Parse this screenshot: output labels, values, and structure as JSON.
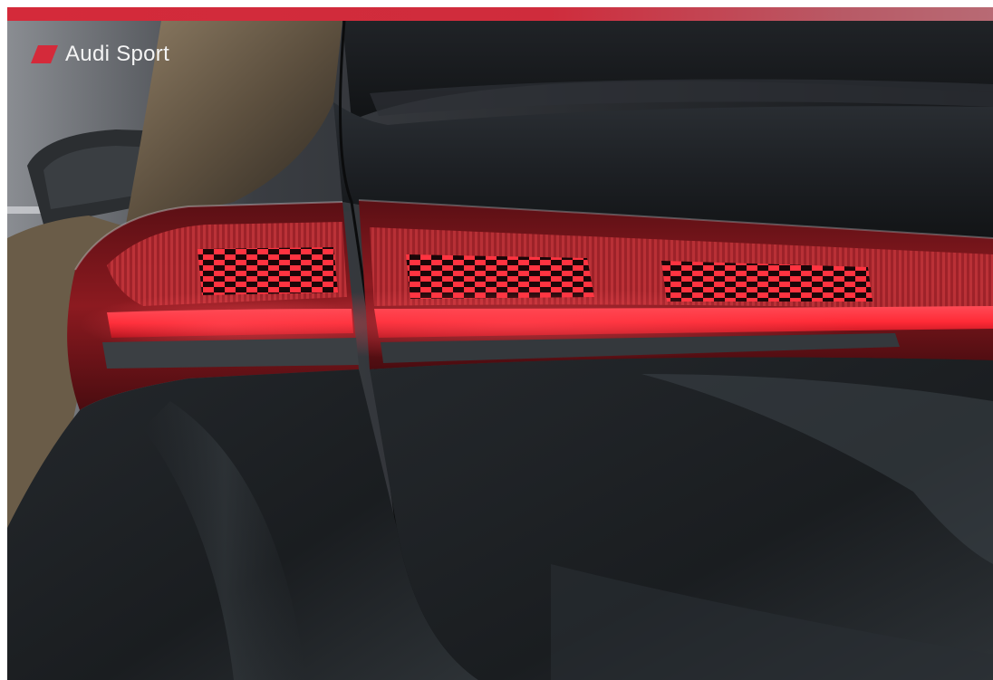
{
  "brand": {
    "name": "Audi Sport",
    "accent_color": "#d42a3a"
  },
  "image": {
    "subject": "tail-light",
    "icon": "car-tail-light-icon"
  }
}
